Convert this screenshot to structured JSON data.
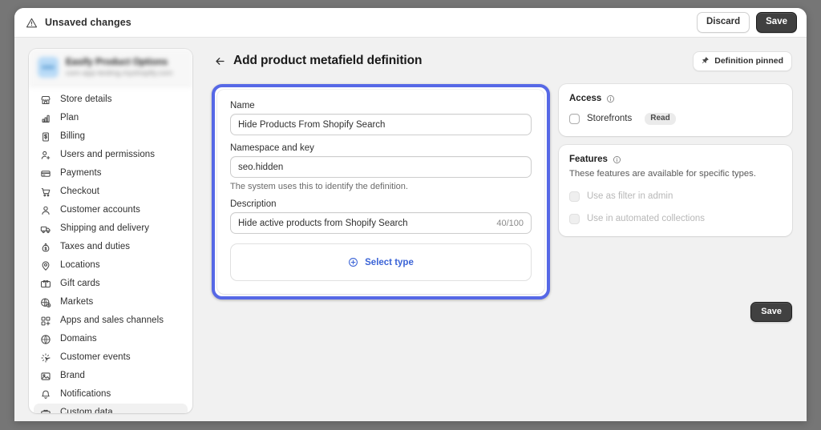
{
  "topbar": {
    "title": "Unsaved changes",
    "warn_icon": "warning-triangle-icon",
    "discard_label": "Discard",
    "save_label": "Save"
  },
  "sidebar": {
    "store": {
      "name": "Easify Product Options",
      "url": "com-app-testing.myshopify.com"
    },
    "items": [
      {
        "label": "Store details",
        "icon": "storefront-icon",
        "active": false
      },
      {
        "label": "Plan",
        "icon": "chart-bar-icon",
        "active": false
      },
      {
        "label": "Billing",
        "icon": "receipt-icon",
        "active": false
      },
      {
        "label": "Users and permissions",
        "icon": "person-add-icon",
        "active": false
      },
      {
        "label": "Payments",
        "icon": "credit-card-icon",
        "active": false
      },
      {
        "label": "Checkout",
        "icon": "cart-icon",
        "active": false
      },
      {
        "label": "Customer accounts",
        "icon": "person-icon",
        "active": false
      },
      {
        "label": "Shipping and delivery",
        "icon": "truck-icon",
        "active": false
      },
      {
        "label": "Taxes and duties",
        "icon": "tax-bag-icon",
        "active": false
      },
      {
        "label": "Locations",
        "icon": "location-pin-icon",
        "active": false
      },
      {
        "label": "Gift cards",
        "icon": "gift-card-icon",
        "active": false
      },
      {
        "label": "Markets",
        "icon": "globe-money-icon",
        "active": false
      },
      {
        "label": "Apps and sales channels",
        "icon": "apps-grid-icon",
        "active": false
      },
      {
        "label": "Domains",
        "icon": "globe-icon",
        "active": false
      },
      {
        "label": "Customer events",
        "icon": "cursor-click-icon",
        "active": false
      },
      {
        "label": "Brand",
        "icon": "image-icon",
        "active": false
      },
      {
        "label": "Notifications",
        "icon": "bell-icon",
        "active": false
      },
      {
        "label": "Custom data",
        "icon": "database-icon",
        "active": true
      }
    ]
  },
  "main": {
    "back_icon": "arrow-left-icon",
    "title": "Add product metafield definition",
    "pinned": {
      "label": "Definition pinned",
      "icon": "pin-icon"
    }
  },
  "form": {
    "name": {
      "label": "Name",
      "value": "Hide Products From Shopify Search"
    },
    "namespace": {
      "label": "Namespace and key",
      "value": "seo.hidden",
      "help": "The system uses this to identify the definition."
    },
    "description": {
      "label": "Description",
      "value": "Hide active products from Shopify Search",
      "counter": "40/100"
    },
    "select_type": {
      "label": "Select type",
      "icon": "plus-circle-icon"
    }
  },
  "access": {
    "title": "Access",
    "info_icon": "info-circle-icon",
    "rows": [
      {
        "label": "Storefronts",
        "badge": "Read",
        "checked": false,
        "disabled": false
      }
    ]
  },
  "features": {
    "title": "Features",
    "info_icon": "info-circle-icon",
    "description": "These features are available for specific types.",
    "rows": [
      {
        "label": "Use as filter in admin",
        "checked": false,
        "disabled": true
      },
      {
        "label": "Use in automated collections",
        "checked": false,
        "disabled": true
      }
    ]
  },
  "bottom": {
    "save_label": "Save"
  },
  "colors": {
    "accent_focus_ring": "#5668e6",
    "link_blue": "#3a63d6",
    "page_bg": "#f1f1f1",
    "desktop_bg": "#767676",
    "primary_button": "#404040"
  }
}
